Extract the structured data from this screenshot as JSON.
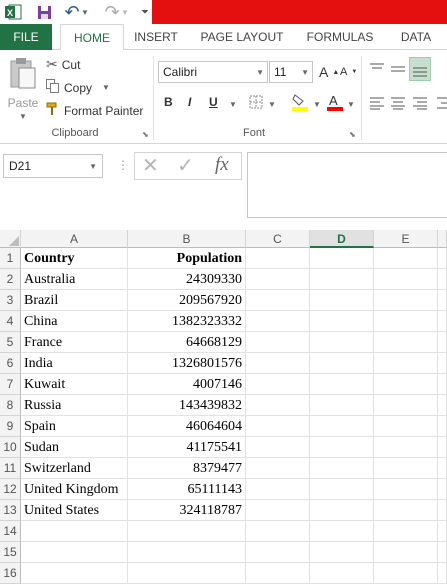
{
  "qat": {
    "undo_label": "↶",
    "redo_label": "↷"
  },
  "tabs": [
    "FILE",
    "HOME",
    "INSERT",
    "PAGE LAYOUT",
    "FORMULAS",
    "DATA"
  ],
  "clipboard": {
    "paste": "Paste",
    "cut": "Cut",
    "copy": "Copy",
    "format_painter": "Format Painter",
    "group_label": "Clipboard"
  },
  "font": {
    "family": "Calibri",
    "size": "11",
    "bold": "B",
    "italic": "I",
    "underline": "U",
    "group_label": "Font"
  },
  "formula_bar": {
    "cell_ref": "D21",
    "fx": "fx"
  },
  "colors": {
    "accent": "#217346",
    "title_bar": "#e3100f",
    "fill_yellow": "#ffff00",
    "font_red": "#ff0000"
  },
  "sheet": {
    "columns": [
      "A",
      "B",
      "C",
      "D",
      "E"
    ],
    "selected_column": "D",
    "rows": [
      "1",
      "2",
      "3",
      "4",
      "5",
      "6",
      "7",
      "8",
      "9",
      "10",
      "11",
      "12",
      "13",
      "14",
      "15",
      "16"
    ],
    "header": {
      "country": "Country",
      "population": "Population"
    },
    "data": [
      {
        "country": "Australia",
        "population": "24309330"
      },
      {
        "country": "Brazil",
        "population": "209567920"
      },
      {
        "country": "China",
        "population": "1382323332"
      },
      {
        "country": "France",
        "population": "64668129"
      },
      {
        "country": "India",
        "population": "1326801576"
      },
      {
        "country": "Kuwait",
        "population": "4007146"
      },
      {
        "country": "Russia",
        "population": "143439832"
      },
      {
        "country": "Spain",
        "population": "46064604"
      },
      {
        "country": "Sudan",
        "population": "41175541"
      },
      {
        "country": "Switzerland",
        "population": "8379477"
      },
      {
        "country": "United Kingdom",
        "population": "65111143"
      },
      {
        "country": "United States",
        "population": "324118787"
      }
    ]
  }
}
